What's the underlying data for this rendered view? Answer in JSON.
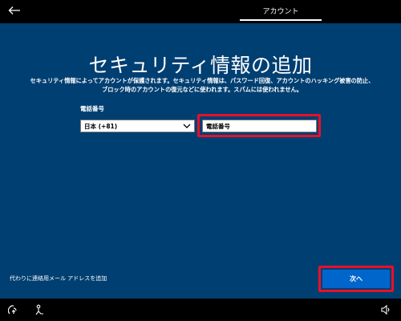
{
  "header": {
    "tab_label": "アカウント"
  },
  "main": {
    "title": "セキュリティ情報の追加",
    "description_line1": "セキュリティ情報によってアカウントが保護されます。セキュリティ情報は、パスワード回復、アカウントのハッキング被害の防止、",
    "description_line2": "ブロック時のアカウントの復元などに使われます。スパムには使われません。",
    "phone_label": "電話番号",
    "country_value": "日本 (+81)",
    "phone_placeholder": "電話番号",
    "alt_email_link": "代わりに連絡用メール アドレスを追加",
    "next_button": "次へ"
  },
  "colors": {
    "panel_blue": "#003f72",
    "highlight_red": "#e8102a",
    "button_blue": "#0066cc"
  },
  "icons": {
    "top_left": "back-arrow-icon",
    "bottom_left_1": "ease-of-access-icon",
    "bottom_left_2": "accessibility-person-icon",
    "bottom_right": "volume-icon"
  }
}
